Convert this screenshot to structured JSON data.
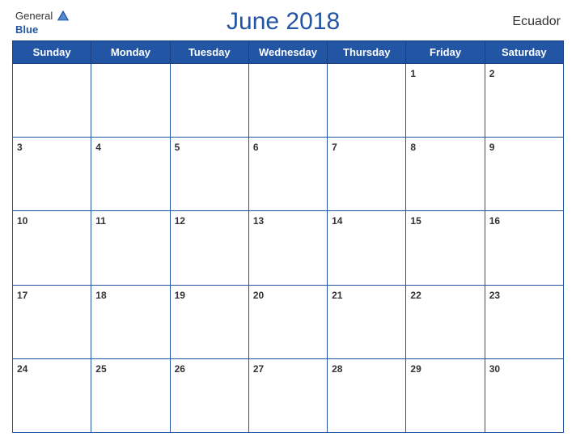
{
  "header": {
    "logo_general": "General",
    "logo_blue": "Blue",
    "title": "June 2018",
    "country": "Ecuador"
  },
  "days_of_week": [
    "Sunday",
    "Monday",
    "Tuesday",
    "Wednesday",
    "Thursday",
    "Friday",
    "Saturday"
  ],
  "weeks": [
    [
      null,
      null,
      null,
      null,
      null,
      1,
      2
    ],
    [
      3,
      4,
      5,
      6,
      7,
      8,
      9
    ],
    [
      10,
      11,
      12,
      13,
      14,
      15,
      16
    ],
    [
      17,
      18,
      19,
      20,
      21,
      22,
      23
    ],
    [
      24,
      25,
      26,
      27,
      28,
      29,
      30
    ]
  ]
}
